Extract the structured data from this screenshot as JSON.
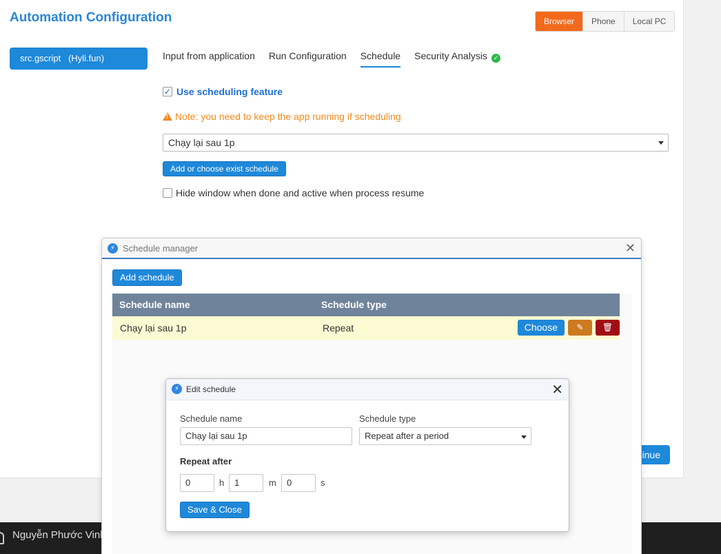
{
  "app": {
    "title": "Automation Configuration",
    "script_button": "src.gscript   (Hyli.fun)"
  },
  "platforms": [
    {
      "label": "Browser",
      "active": true
    },
    {
      "label": "Phone",
      "active": false
    },
    {
      "label": "Local PC",
      "active": false
    }
  ],
  "tabs": [
    {
      "label": "Input from application",
      "active": false
    },
    {
      "label": "Run Configuration",
      "active": false
    },
    {
      "label": "Schedule",
      "active": true
    },
    {
      "label": "Security Analysis",
      "active": false,
      "status_icon": "check-circle-icon"
    }
  ],
  "schedule_tab": {
    "use_scheduling_label": "Use scheduling feature",
    "use_scheduling_checked": true,
    "note": "Note: you need to keep the app running if scheduling",
    "selected_schedule": "Chạy lại sau 1p",
    "add_choose_button": "Add or choose exist schedule",
    "hide_window_label": "Hide window when done and active when process resume",
    "hide_window_checked": false,
    "continue_button": "inue"
  },
  "schedule_manager": {
    "title": "Schedule manager",
    "add_button": "Add schedule",
    "columns": [
      "Schedule name",
      "Schedule type"
    ],
    "rows": [
      {
        "name": "Chạy lại sau 1p",
        "type": "Repeat",
        "choose_label": "Choose"
      }
    ]
  },
  "edit_schedule": {
    "title": "Edit schedule",
    "name_label": "Schedule name",
    "name_value": "Chạy lại sau 1p",
    "type_label": "Schedule type",
    "type_value": "Repeat after a period",
    "repeat_after_label": "Repeat after",
    "hours": "0",
    "hours_unit": "h",
    "minutes": "1",
    "minutes_unit": "m",
    "seconds": "0",
    "seconds_unit": "s",
    "save_button": "Save & Close"
  },
  "taskbar": {
    "user_name": "Nguyễn Phước Vinh"
  },
  "colors": {
    "accent": "#1e88d9",
    "browser_active": "#f36a1c",
    "warning": "#f08a1c",
    "row_highlight": "#fcfbd3",
    "table_header": "#6f839b"
  }
}
